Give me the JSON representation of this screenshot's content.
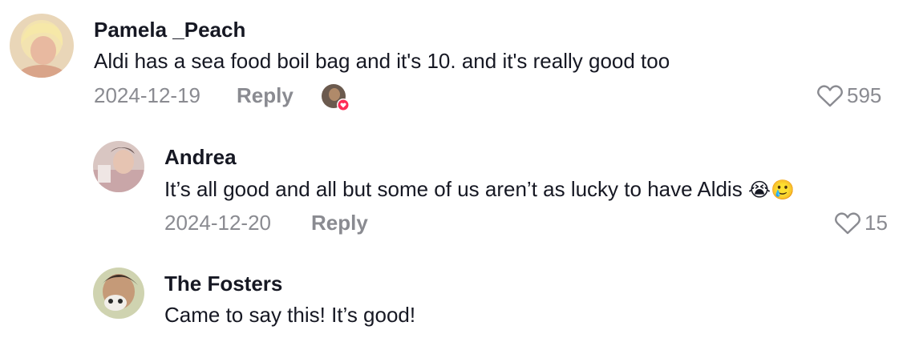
{
  "comments": [
    {
      "username": "Pamela _Peach",
      "text": "Aldi has a sea food boil bag and it's 10. and it's really good too",
      "date": "2024-12-19",
      "reply_label": "Reply",
      "likes": "595",
      "liked_by_creator": true
    },
    {
      "username": "Andrea",
      "text": "It’s all good and all but some of us aren’t as lucky to have Aldis",
      "emojis": "😭🥲",
      "date": "2024-12-20",
      "reply_label": "Reply",
      "likes": "15"
    },
    {
      "username": "The Fosters",
      "text": "Came to say this! It’s good!"
    }
  ],
  "colors": {
    "primary_text": "#161823",
    "secondary_text": "#8a8b91",
    "creator_heart": "#fe2c55"
  }
}
